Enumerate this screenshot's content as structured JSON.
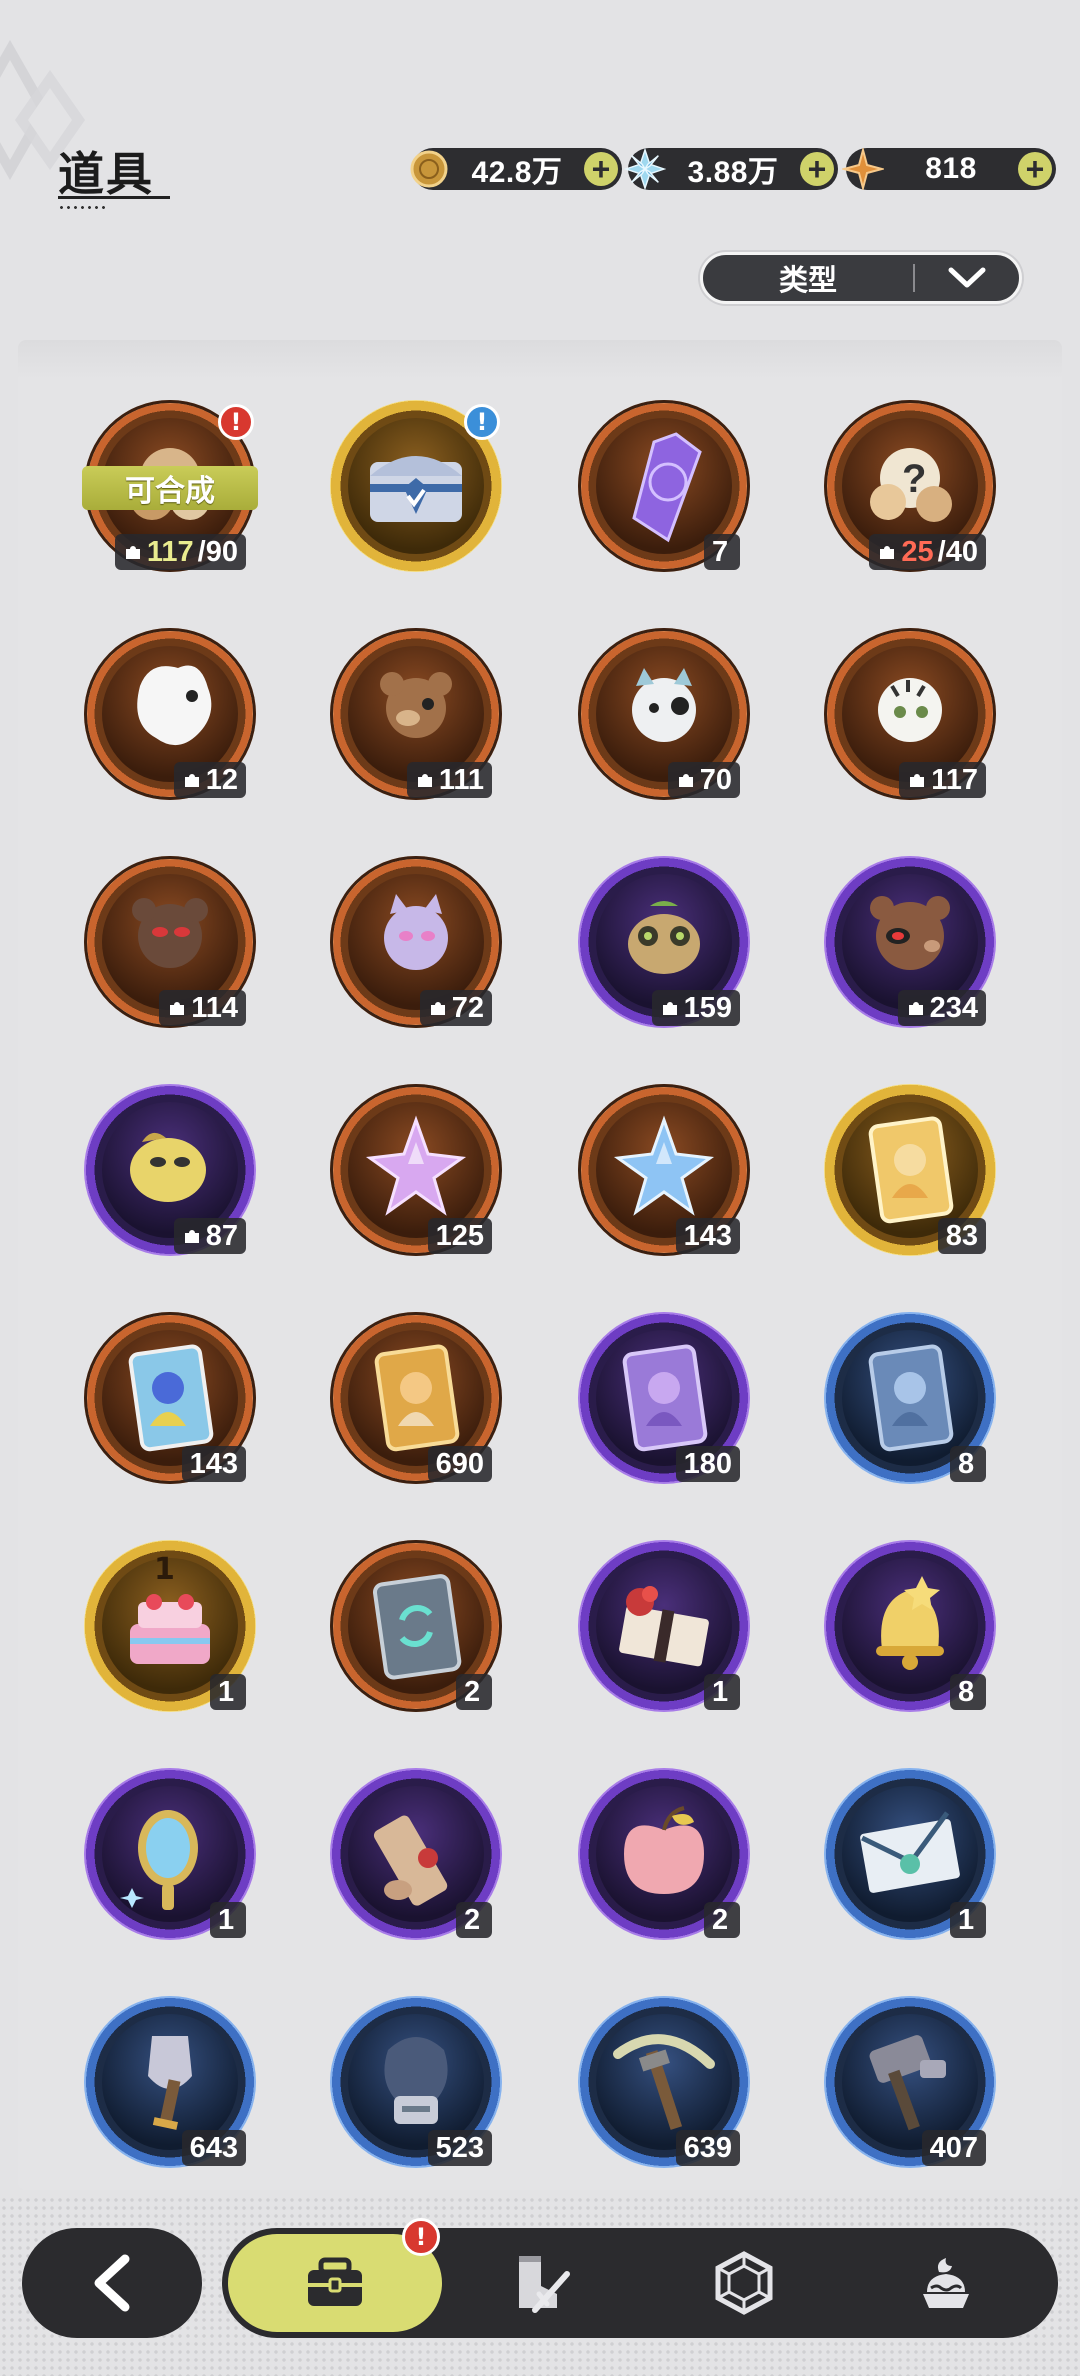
{
  "page": {
    "title": "道具"
  },
  "currencies": [
    {
      "icon": "gold-coin-icon",
      "value": "42.8万",
      "color": "#c8963a"
    },
    {
      "icon": "crystal-gem-icon",
      "value": "3.88万",
      "color": "#8fd0e8"
    },
    {
      "icon": "star-shard-icon",
      "value": "818",
      "color": "#e0903a"
    }
  ],
  "filter": {
    "label": "类型"
  },
  "craft_label": "可合成",
  "cake_top_number": "1",
  "items": [
    {
      "icon": "fragment-bundle-icon",
      "rarity": "orange",
      "count_have": "117",
      "count_need": "/90",
      "have_ok": true,
      "badge": "red",
      "craft": true
    },
    {
      "icon": "treasure-chest-icon",
      "rarity": "gold",
      "badge": "blue"
    },
    {
      "icon": "purple-crystal-icon",
      "rarity": "orange",
      "count": "7"
    },
    {
      "icon": "mystery-fragment-icon",
      "rarity": "orange",
      "count_have": "25",
      "count_need": "/40",
      "have_ok": false
    },
    {
      "icon": "white-ghost-fragment-icon",
      "rarity": "orange",
      "count": "12",
      "frag": true
    },
    {
      "icon": "brown-bear-fragment-icon",
      "rarity": "orange",
      "count": "111",
      "frag": true
    },
    {
      "icon": "white-cat-fragment-icon",
      "rarity": "orange",
      "count": "70",
      "frag": true
    },
    {
      "icon": "tiger-cub-fragment-icon",
      "rarity": "orange",
      "count": "117",
      "frag": true
    },
    {
      "icon": "dark-bear-fragment-icon",
      "rarity": "orange",
      "count": "114",
      "frag": true
    },
    {
      "icon": "lavender-cat-fragment-icon",
      "rarity": "orange",
      "count": "72",
      "frag": true
    },
    {
      "icon": "green-frog-fragment-icon",
      "rarity": "purple",
      "count": "159",
      "frag": true
    },
    {
      "icon": "red-eye-bear-fragment-icon",
      "rarity": "purple",
      "count": "234",
      "frag": true
    },
    {
      "icon": "yellow-blob-fragment-icon",
      "rarity": "purple",
      "count": "87",
      "frag": true
    },
    {
      "icon": "pink-star-crystal-icon",
      "rarity": "orange",
      "count": "125"
    },
    {
      "icon": "blue-star-crystal-icon",
      "rarity": "orange",
      "count": "143"
    },
    {
      "icon": "golden-character-card-icon",
      "rarity": "gold",
      "count": "83"
    },
    {
      "icon": "holo-character-card-icon",
      "rarity": "orange",
      "count": "143"
    },
    {
      "icon": "gold-character-card-icon",
      "rarity": "orange",
      "count": "690"
    },
    {
      "icon": "purple-character-card-icon",
      "rarity": "purple",
      "count": "180"
    },
    {
      "icon": "blue-character-card-icon",
      "rarity": "blue",
      "count": "8"
    },
    {
      "icon": "birthday-cake-icon",
      "rarity": "gold",
      "count": "1",
      "cake": true
    },
    {
      "icon": "refresh-card-icon",
      "rarity": "orange",
      "count": "2"
    },
    {
      "icon": "gift-box-icon",
      "rarity": "purple",
      "count": "1"
    },
    {
      "icon": "golden-bell-icon",
      "rarity": "purple",
      "count": "8"
    },
    {
      "icon": "magic-mirror-icon",
      "rarity": "purple",
      "count": "1"
    },
    {
      "icon": "scroll-icon",
      "rarity": "purple",
      "count": "2"
    },
    {
      "icon": "apple-icon",
      "rarity": "purple",
      "count": "2"
    },
    {
      "icon": "envelope-icon",
      "rarity": "blue",
      "count": "1"
    },
    {
      "icon": "shovel-icon",
      "rarity": "blue",
      "count": "643"
    },
    {
      "icon": "boxing-glove-icon",
      "rarity": "blue",
      "count": "523"
    },
    {
      "icon": "pickaxe-icon",
      "rarity": "blue",
      "count": "639"
    },
    {
      "icon": "hammer-icon",
      "rarity": "blue",
      "count": "407"
    }
  ],
  "nav": {
    "tabs": [
      {
        "icon": "briefcase-icon",
        "active": true
      },
      {
        "icon": "boot-sword-icon"
      },
      {
        "icon": "hexagon-gem-icon"
      },
      {
        "icon": "pudding-icon"
      }
    ],
    "badge": "!"
  }
}
